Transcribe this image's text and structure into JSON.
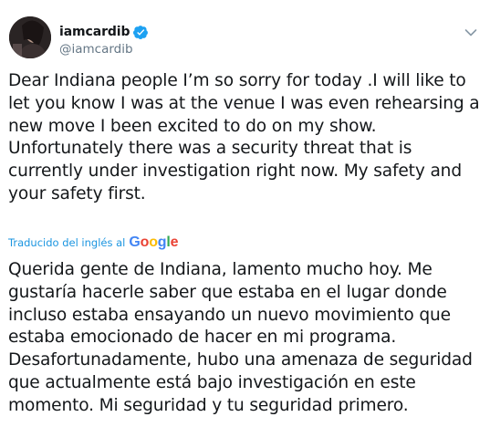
{
  "user": {
    "display_name": "iamcardib",
    "handle": "@iamcardib",
    "verified": true,
    "avatar_icon": "profile-photo"
  },
  "tweet": {
    "text": "Dear Indiana people I’m so sorry for today .I will like to let you know I was at the venue I was even rehearsing a new move I been excited to do on my show. Unfortunately there was a security threat that is currently under investigation right now. My safety and your safety first."
  },
  "translation": {
    "label": "Traducido del inglés al",
    "provider": "Google",
    "text": "Querida gente de Indiana, lamento mucho hoy. Me gustaría hacerle saber que estaba en el lugar donde incluso estaba ensayando un nuevo movimiento que estaba emocionado de hacer en mi programa. Desafortunadamente, hubo una amenaza de seguridad que actualmente está bajo investigación en este momento. Mi seguridad y tu seguridad primero."
  },
  "icons": {
    "verified": "verified-badge-icon",
    "menu": "chevron-down-icon"
  },
  "colors": {
    "text": "#14171a",
    "secondary": "#657786",
    "link": "#1b95e0",
    "verified": "#1da1f2"
  }
}
